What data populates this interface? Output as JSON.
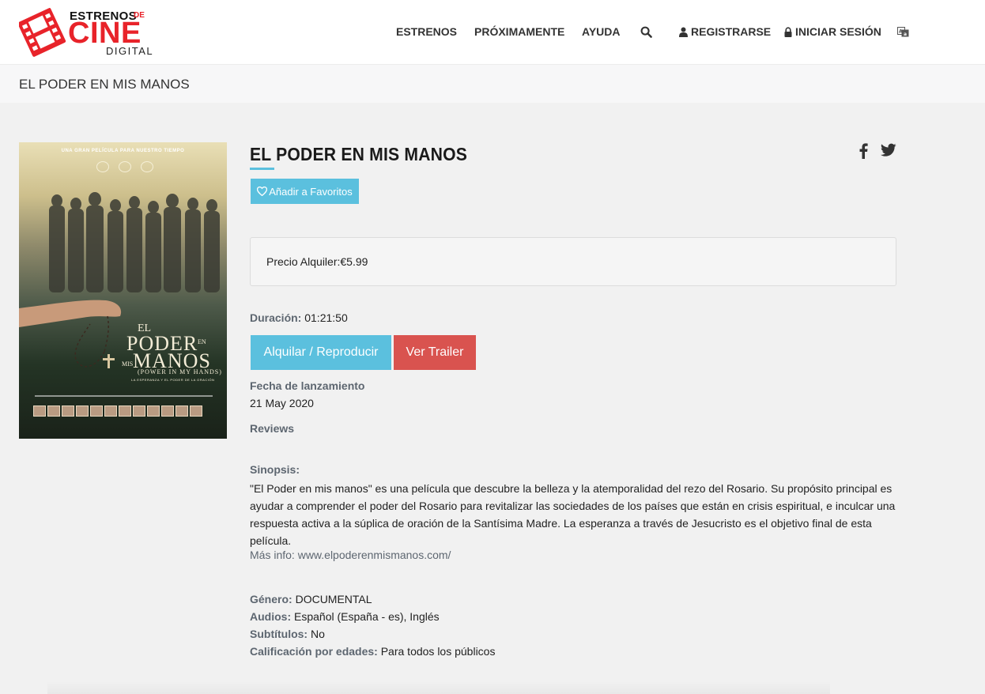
{
  "brand": {
    "line1": "ESTRENOS",
    "line1_suffix": "DE",
    "line2": "CINE",
    "line3": "DIGITAL",
    "accent_color": "#e8232a"
  },
  "nav": {
    "estrenos": "ESTRENOS",
    "proximamente": "PRÓXIMAMENTE",
    "ayuda": "AYUDA",
    "search_icon": "search-icon",
    "registrarse": "REGISTRARSE",
    "iniciar_sesion": "INICIAR SESIÓN",
    "language_icon": "language-icon"
  },
  "breadcrumb": "EL PODER EN MIS MANOS",
  "poster": {
    "tagline": "UNA GRAN PELÍCULA PARA NUESTRO TIEMPO",
    "title_el": "EL",
    "title_poder": "PODER",
    "title_en": "EN",
    "title_mis": "MIS",
    "title_manos": "MANOS",
    "title_en_ingles": "(POWER IN MY HANDS)",
    "title_sub": "LA ESPERANZA Y EL PODER DE LA ORACIÓN"
  },
  "movie": {
    "title": "EL PODER EN MIS MANOS",
    "favorite_label": "Añadir a Favoritos",
    "price_label": "Precio Alquiler:",
    "price_value": "€5.99",
    "duration_label": "Duración:",
    "duration_value": "01:21:50",
    "rent_button": "Alquilar / Reproducir",
    "trailer_button": "Ver Trailer",
    "release_label": "Fecha de lanzamiento",
    "release_value": "21 May 2020",
    "reviews_label": "Reviews",
    "synopsis_label": "Sinopsis:",
    "synopsis_text": "\"El Poder en mis manos\" es una película que descubre la belleza y la atemporalidad del rezo del Rosario. Su propósito principal es ayudar a comprender el poder del Rosario para revitalizar las sociedades de los países que están en crisis espiritual, e inculcar una respuesta activa a la súplica de oración de la Santísima Madre. La esperanza a través de Jesucristo es el objetivo final de esta película.",
    "more_info_label": "Más info:",
    "more_info_link": "www.elpoderenmismanos.com/",
    "genre_label": "Género:",
    "genre_value": "DOCUMENTAL",
    "audio_label": "Audios:",
    "audio_value": "Español (España - es), Inglés",
    "subtitles_label": "Subtítulos:",
    "subtitles_value": "No",
    "rating_label": "Calificación por edades:",
    "rating_value": "Para todos los públicos"
  },
  "colors": {
    "info_blue": "#5bc0de",
    "danger_red": "#d9534f",
    "label_gray": "#5d6670"
  }
}
